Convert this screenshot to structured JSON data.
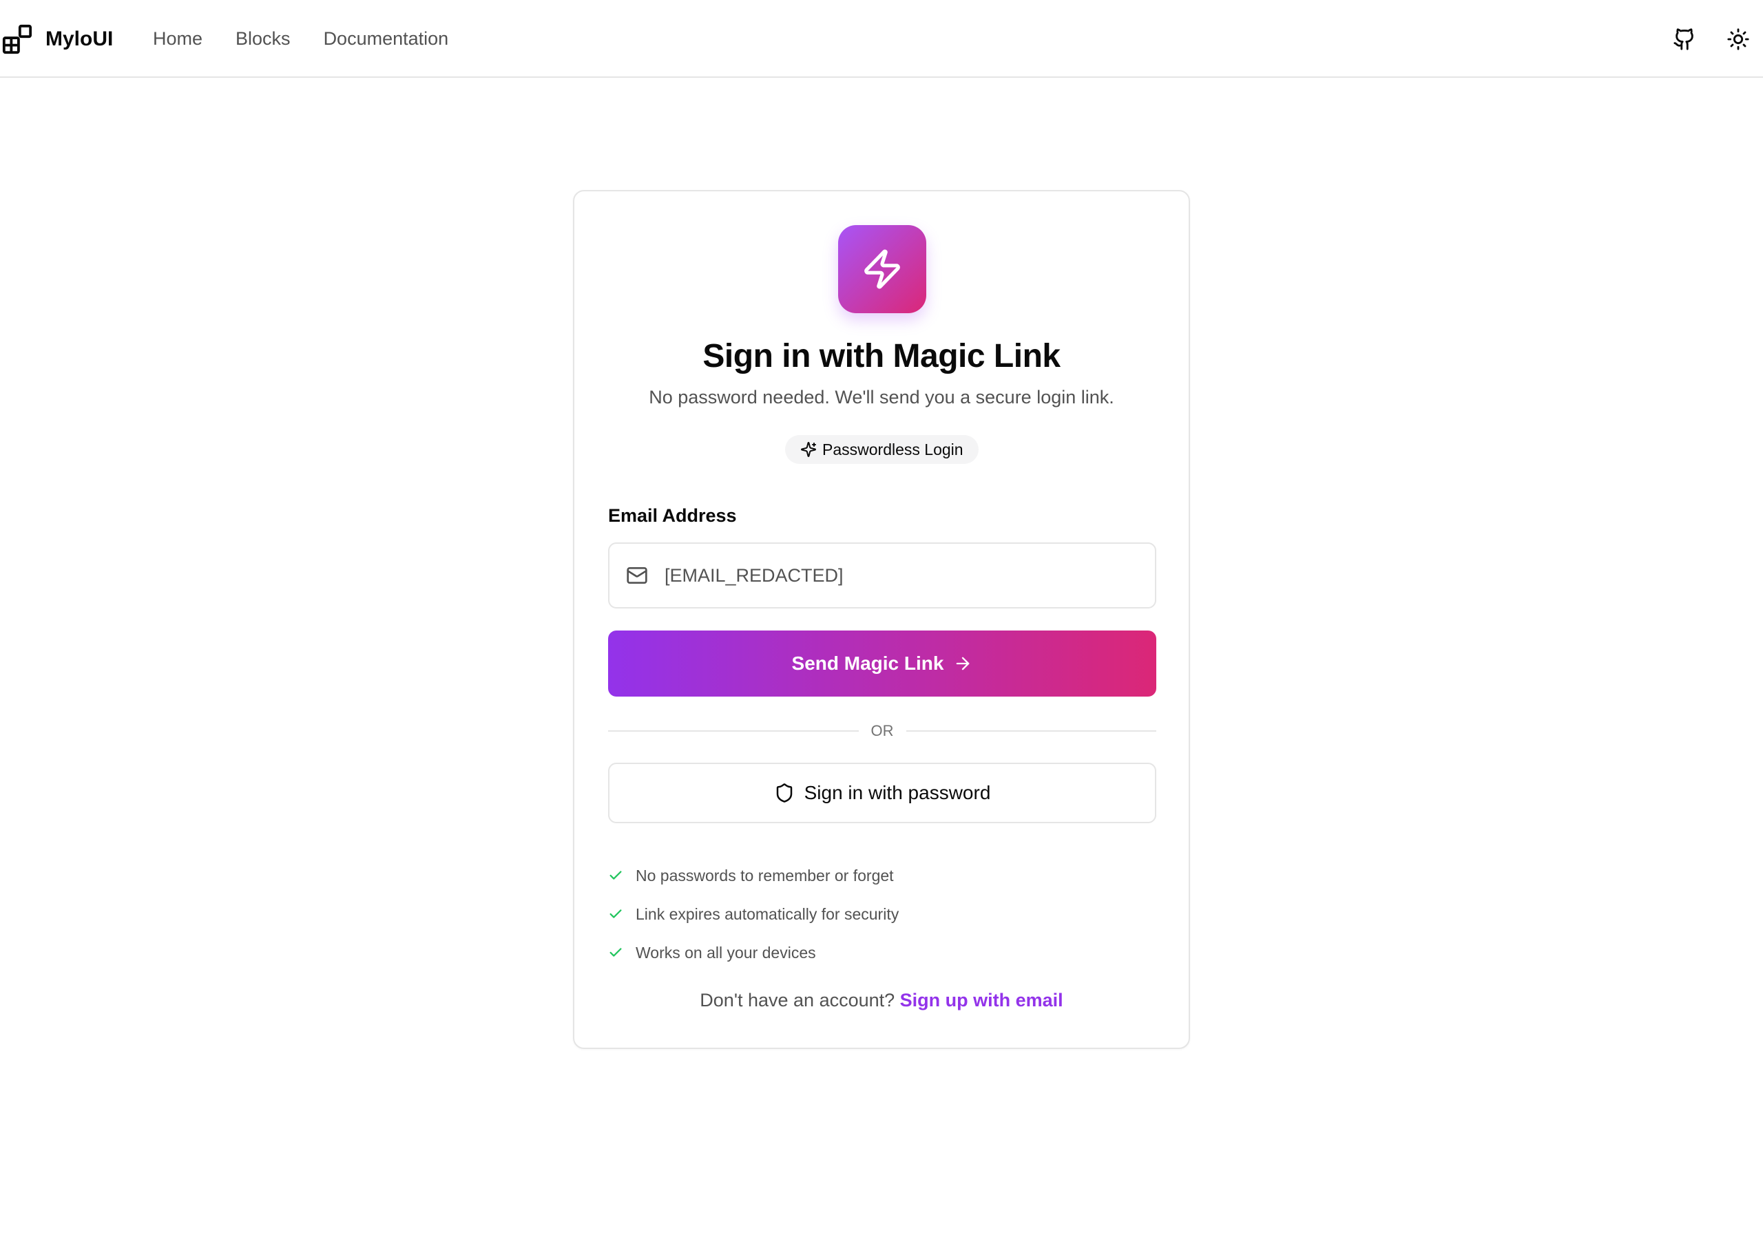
{
  "nav": {
    "brand": "MyloUI",
    "links": [
      "Home",
      "Blocks",
      "Documentation"
    ],
    "icons": {
      "github": "github-icon",
      "theme": "sun-icon"
    }
  },
  "card": {
    "hero_icon": "lightning-bolt-icon",
    "title": "Sign in with Magic Link",
    "subtitle": "No password needed. We'll send you a secure login link.",
    "badge": "Passwordless Login",
    "email_label": "Email Address",
    "email_value": "[EMAIL_REDACTED]",
    "primary_button": "Send Magic Link",
    "divider": "OR",
    "secondary_button": "Sign in with password",
    "features": [
      "No passwords to remember or forget",
      "Link expires automatically for security",
      "Works on all your devices"
    ],
    "footer_text": "Don't have an account?",
    "footer_link": "Sign up with email"
  },
  "colors": {
    "accent_start": "#9333ea",
    "accent_end": "#db2777",
    "check": "#22c55e",
    "border": "#e5e5e5",
    "muted_text": "#525252"
  }
}
